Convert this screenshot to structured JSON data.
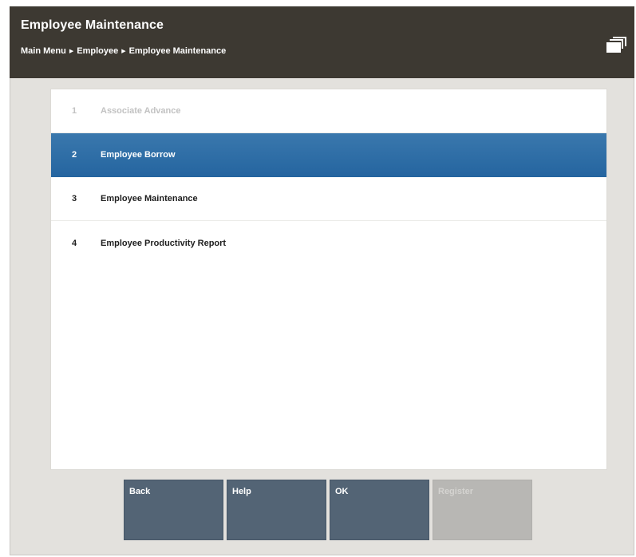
{
  "header": {
    "title": "Employee Maintenance",
    "breadcrumb": [
      "Main Menu",
      "Employee",
      "Employee Maintenance"
    ],
    "icon": "windows-icon"
  },
  "menu": {
    "items": [
      {
        "number": "1",
        "label": "Associate Advance",
        "state": "disabled"
      },
      {
        "number": "2",
        "label": "Employee Borrow",
        "state": "selected"
      },
      {
        "number": "3",
        "label": "Employee Maintenance",
        "state": "normal"
      },
      {
        "number": "4",
        "label": "Employee Productivity Report",
        "state": "normal"
      }
    ]
  },
  "buttons": {
    "back": "Back",
    "help": "Help",
    "ok": "OK",
    "register": "Register"
  },
  "colors": {
    "header_bg": "#3d3932",
    "selected_row": "#2565a0",
    "button_bg": "#536475",
    "button_disabled": "#b8b7b4",
    "frame_bg": "#e3e1dd"
  }
}
